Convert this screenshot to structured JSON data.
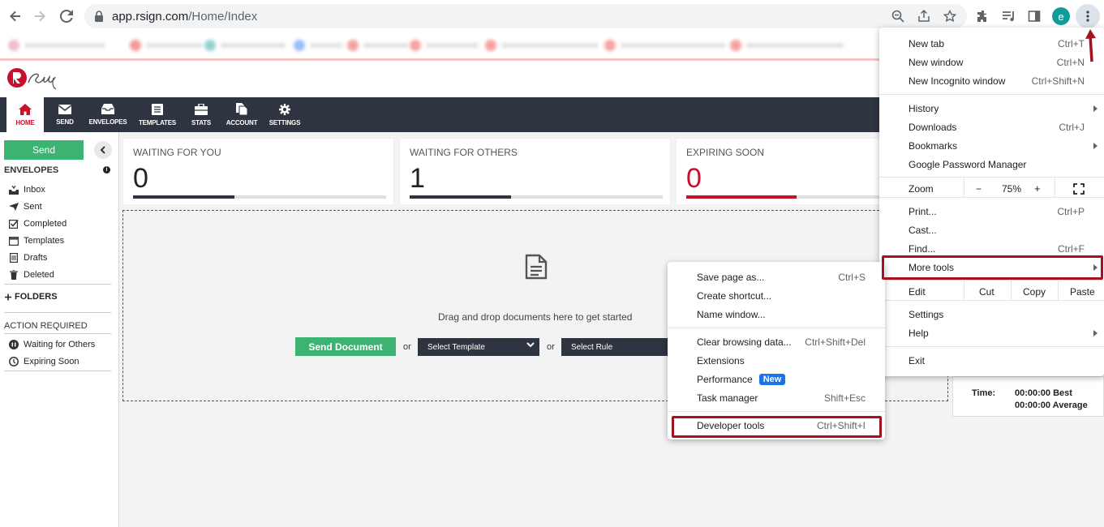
{
  "browser": {
    "url_host": "app.rsign.com",
    "url_path": "/Home/Index",
    "profile_initial": "e",
    "profile_color": "#0f9d9a"
  },
  "app": {
    "brand_color": "#c8102e",
    "nav": [
      {
        "label": "HOME",
        "icon": "home-icon"
      },
      {
        "label": "SEND",
        "icon": "envelope-icon"
      },
      {
        "label": "ENVELOPES",
        "icon": "inbox-tray-icon"
      },
      {
        "label": "TEMPLATES",
        "icon": "document-list-icon"
      },
      {
        "label": "STATS",
        "icon": "briefcase-icon"
      },
      {
        "label": "ACCOUNT",
        "icon": "documents-icon"
      },
      {
        "label": "SETTINGS",
        "icon": "gear-icon"
      }
    ]
  },
  "sidebar": {
    "send_label": "Send",
    "envelopes_heading": "ENVELOPES",
    "envelope_items": [
      {
        "label": "Inbox",
        "icon": "inbox-icon"
      },
      {
        "label": "Sent",
        "icon": "paper-plane-icon"
      },
      {
        "label": "Completed",
        "icon": "checkbox-icon"
      },
      {
        "label": "Templates",
        "icon": "template-icon"
      },
      {
        "label": "Drafts",
        "icon": "drafts-icon"
      },
      {
        "label": "Deleted",
        "icon": "trash-icon"
      }
    ],
    "folders_label": "FOLDERS",
    "action_heading": "ACTION REQUIRED",
    "action_items": [
      {
        "label": "Waiting for Others",
        "icon": "pause-icon"
      },
      {
        "label": "Expiring Soon",
        "icon": "clock-icon"
      }
    ]
  },
  "stats": [
    {
      "label": "WAITING FOR YOU",
      "value": "0",
      "fill": 0.4,
      "color": "#2e3440"
    },
    {
      "label": "WAITING FOR OTHERS",
      "value": "1",
      "fill": 0.4,
      "color": "#2e3440"
    },
    {
      "label": "EXPIRING SOON",
      "value": "0",
      "fill": 0.4,
      "color": "#c8102e"
    }
  ],
  "dropzone": {
    "text": "Drag and drop documents here to get started",
    "send_document": "Send Document",
    "or1": "or",
    "select_template": "Select Template",
    "or2": "or",
    "select_rule": "Select Rule"
  },
  "time_panel": {
    "label": "Time:",
    "best": "00:00:00 Best",
    "average": "00:00:00 Average"
  },
  "chrome_menu": {
    "new_tab": "New tab",
    "new_tab_sc": "Ctrl+T",
    "new_window": "New window",
    "new_window_sc": "Ctrl+N",
    "incognito": "New Incognito window",
    "incognito_sc": "Ctrl+Shift+N",
    "history": "History",
    "downloads": "Downloads",
    "downloads_sc": "Ctrl+J",
    "bookmarks": "Bookmarks",
    "password_manager": "Google Password Manager",
    "zoom": "Zoom",
    "zoom_minus": "−",
    "zoom_value": "75%",
    "zoom_plus": "+",
    "print": "Print...",
    "print_sc": "Ctrl+P",
    "cast": "Cast...",
    "find": "Find...",
    "find_sc": "Ctrl+F",
    "more_tools": "More tools",
    "edit": "Edit",
    "cut": "Cut",
    "copy": "Copy",
    "paste": "Paste",
    "settings": "Settings",
    "help": "Help",
    "exit": "Exit"
  },
  "more_tools_menu": {
    "save_page": "Save page as...",
    "save_page_sc": "Ctrl+S",
    "create_shortcut": "Create shortcut...",
    "name_window": "Name window...",
    "clear_data": "Clear browsing data...",
    "clear_data_sc": "Ctrl+Shift+Del",
    "extensions": "Extensions",
    "performance": "Performance",
    "performance_badge": "New",
    "task_manager": "Task manager",
    "task_manager_sc": "Shift+Esc",
    "developer_tools": "Developer tools",
    "developer_tools_sc": "Ctrl+Shift+I"
  },
  "highlight_color": "#a5121f"
}
